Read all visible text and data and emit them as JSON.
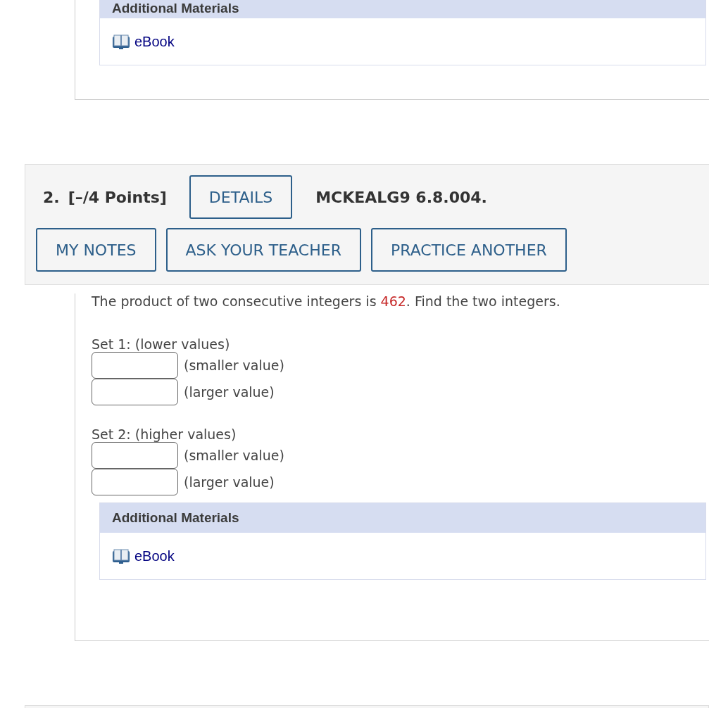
{
  "previous_question": {
    "additional_materials": {
      "title": "Additional Materials",
      "links": [
        {
          "label": "eBook"
        }
      ]
    }
  },
  "question": {
    "number": "2.",
    "points": "[–/4 Points]",
    "details_button": "DETAILS",
    "code": "MCKEALG9 6.8.004.",
    "buttons": [
      "MY NOTES",
      "ASK YOUR TEACHER",
      "PRACTICE ANOTHER"
    ],
    "prompt": [
      {
        "text": "The product of two consecutive integers is ",
        "kind": "plain"
      },
      {
        "text": "462",
        "kind": "given"
      },
      {
        "text": ". Find the two integers.",
        "kind": "plain"
      }
    ],
    "sets": [
      {
        "label": "Set 1: (lower values)",
        "answers": [
          {
            "label": "(smaller value)"
          },
          {
            "label": "(larger value)"
          }
        ]
      },
      {
        "label": "Set 2: (higher values)",
        "answers": [
          {
            "label": "(smaller value)"
          },
          {
            "label": "(larger value)"
          }
        ]
      }
    ],
    "additional_materials": {
      "title": "Additional Materials",
      "links": [
        {
          "label": "eBook"
        }
      ]
    }
  }
}
